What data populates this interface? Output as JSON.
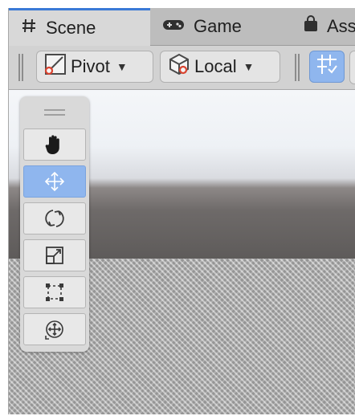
{
  "tabs": [
    {
      "label": "Scene",
      "icon": "hash-icon",
      "active": true
    },
    {
      "label": "Game",
      "icon": "gamepad-icon",
      "active": false
    },
    {
      "label": "Ass",
      "icon": "store-bag-icon",
      "active": false
    }
  ],
  "toolbar": {
    "pivot_label": "Pivot",
    "local_label": "Local",
    "grid_snap_icon": "grid-snap-icon"
  },
  "tools": [
    {
      "name": "hand-tool",
      "icon": "hand-icon",
      "active": false
    },
    {
      "name": "move-tool",
      "icon": "move-arrows-icon",
      "active": true
    },
    {
      "name": "rotate-tool",
      "icon": "rotate-icon",
      "active": false
    },
    {
      "name": "scale-tool",
      "icon": "scale-icon",
      "active": false
    },
    {
      "name": "rect-tool",
      "icon": "rect-transform-icon",
      "active": false
    },
    {
      "name": "transform-tool",
      "icon": "transform-icon",
      "active": false
    }
  ],
  "colors": {
    "accent": "#8fb6ee",
    "active_tab_underline": "#3a79d6"
  }
}
